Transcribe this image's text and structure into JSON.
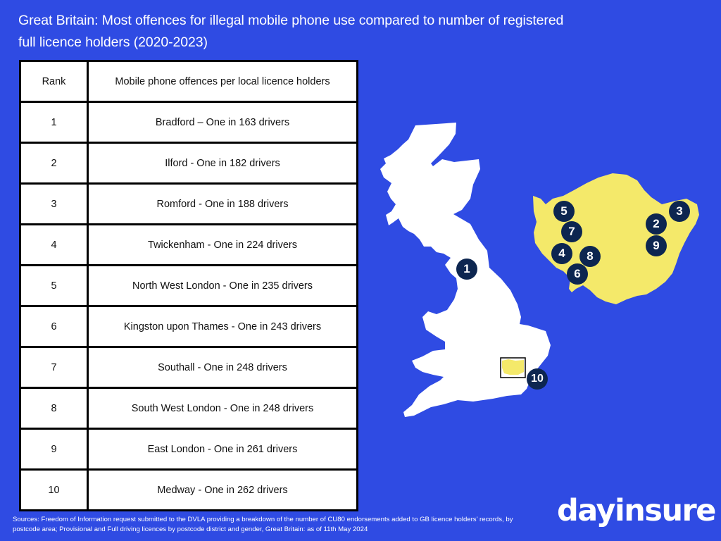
{
  "title": "Great Britain: Most offences for illegal mobile phone use compared to number of registered full licence holders (2020-2023)",
  "colors": {
    "background": "#2f4be3",
    "map_land": "#ffffff",
    "london_fill": "#f4e96a",
    "marker": "#0d2650"
  },
  "table": {
    "headers": [
      "Rank",
      "Mobile phone offences per local licence holders"
    ],
    "rows": [
      {
        "rank": "1",
        "text": "Bradford – One in 163 drivers"
      },
      {
        "rank": "2",
        "text": "Ilford - One in 182 drivers"
      },
      {
        "rank": "3",
        "text": "Romford - One in 188 drivers"
      },
      {
        "rank": "4",
        "text": "Twickenham - One in 224 drivers"
      },
      {
        "rank": "5",
        "text": "North West London - One in 235 drivers"
      },
      {
        "rank": "6",
        "text": "Kingston upon Thames - One in 243 drivers"
      },
      {
        "rank": "7",
        "text": "Southall - One in 248 drivers"
      },
      {
        "rank": "8",
        "text": "South West London - One in 248 drivers"
      },
      {
        "rank": "9",
        "text": "East London - One in 261 drivers"
      },
      {
        "rank": "10",
        "text": "Medway - One in 262 drivers"
      }
    ]
  },
  "map": {
    "gb_markers": [
      "1",
      "10"
    ],
    "london_markers": [
      "5",
      "7",
      "4",
      "8",
      "6",
      "3",
      "2",
      "9"
    ]
  },
  "sources": "Sources: Freedom of Information request submitted to the DVLA providing a breakdown of the number of CU80 endorsements added to GB licence holders’ records, by postcode area; Provisional and Full driving licences by postcode district and gender, Great Britain: as of 11th May 2024",
  "logo": "dayinsure"
}
